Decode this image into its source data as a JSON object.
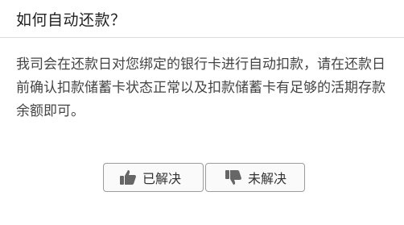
{
  "title": "如何自动还款？",
  "body": "我司会在还款日对您绑定的银行卡进行自动扣款，请在还款日前确认扣款储蓄卡状态正常以及扣款储蓄卡有足够的活期存款余额即可。",
  "actions": {
    "resolved": {
      "label": "已解决",
      "icon": "thumbs-up-icon"
    },
    "unresolved": {
      "label": "未解决",
      "icon": "thumbs-down-icon"
    }
  },
  "colors": {
    "text": "#333333",
    "border": "#9c9c9c",
    "icon": "#666666",
    "divider": "#dcdcdc"
  }
}
